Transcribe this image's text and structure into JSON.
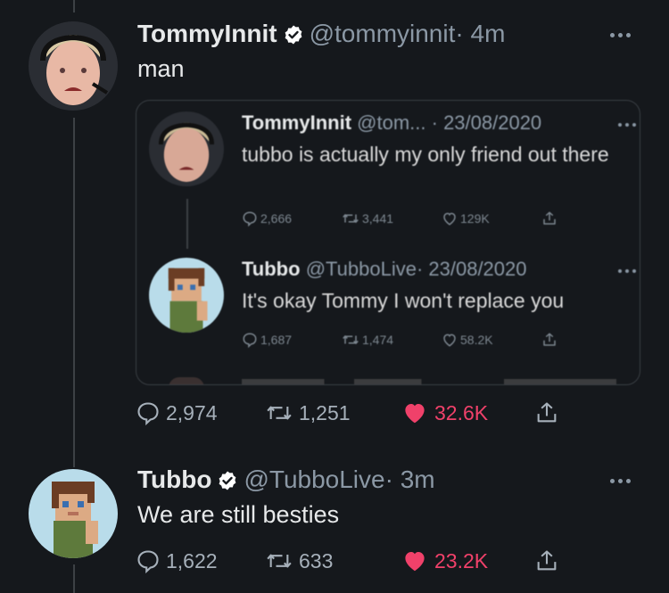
{
  "tweets": [
    {
      "display_name": "TommyInnit",
      "handle": "@tommyinnit",
      "time": "· 4m",
      "text": "man",
      "stats": {
        "replies": "2,974",
        "retweets": "1,251",
        "likes": "32.6K"
      }
    },
    {
      "display_name": "Tubbo",
      "handle": "@TubboLive",
      "time": "· 3m",
      "text": "We are still besties",
      "stats": {
        "replies": "1,622",
        "retweets": "633",
        "likes": "23.2K"
      }
    }
  ],
  "quoted": [
    {
      "display_name": "TommyInnit",
      "handle": "@tom...",
      "time": "· 23/08/2020",
      "text": "tubbo is actually my only friend out there",
      "stats": {
        "replies": "2,666",
        "retweets": "3,441",
        "likes": "129K"
      }
    },
    {
      "display_name": "Tubbo",
      "handle": "@TubboLive",
      "time": "· 23/08/2020",
      "text": "It's okay Tommy I won't replace you",
      "stats": {
        "replies": "1,687",
        "retweets": "1,474",
        "likes": "58.2K"
      }
    }
  ],
  "colors": {
    "like": "#f0416a",
    "verified": "#ffffff",
    "background": "#15181c"
  },
  "icons": [
    "reply-icon",
    "retweet-icon",
    "heart-icon",
    "share-icon",
    "verified-icon",
    "more-icon"
  ]
}
